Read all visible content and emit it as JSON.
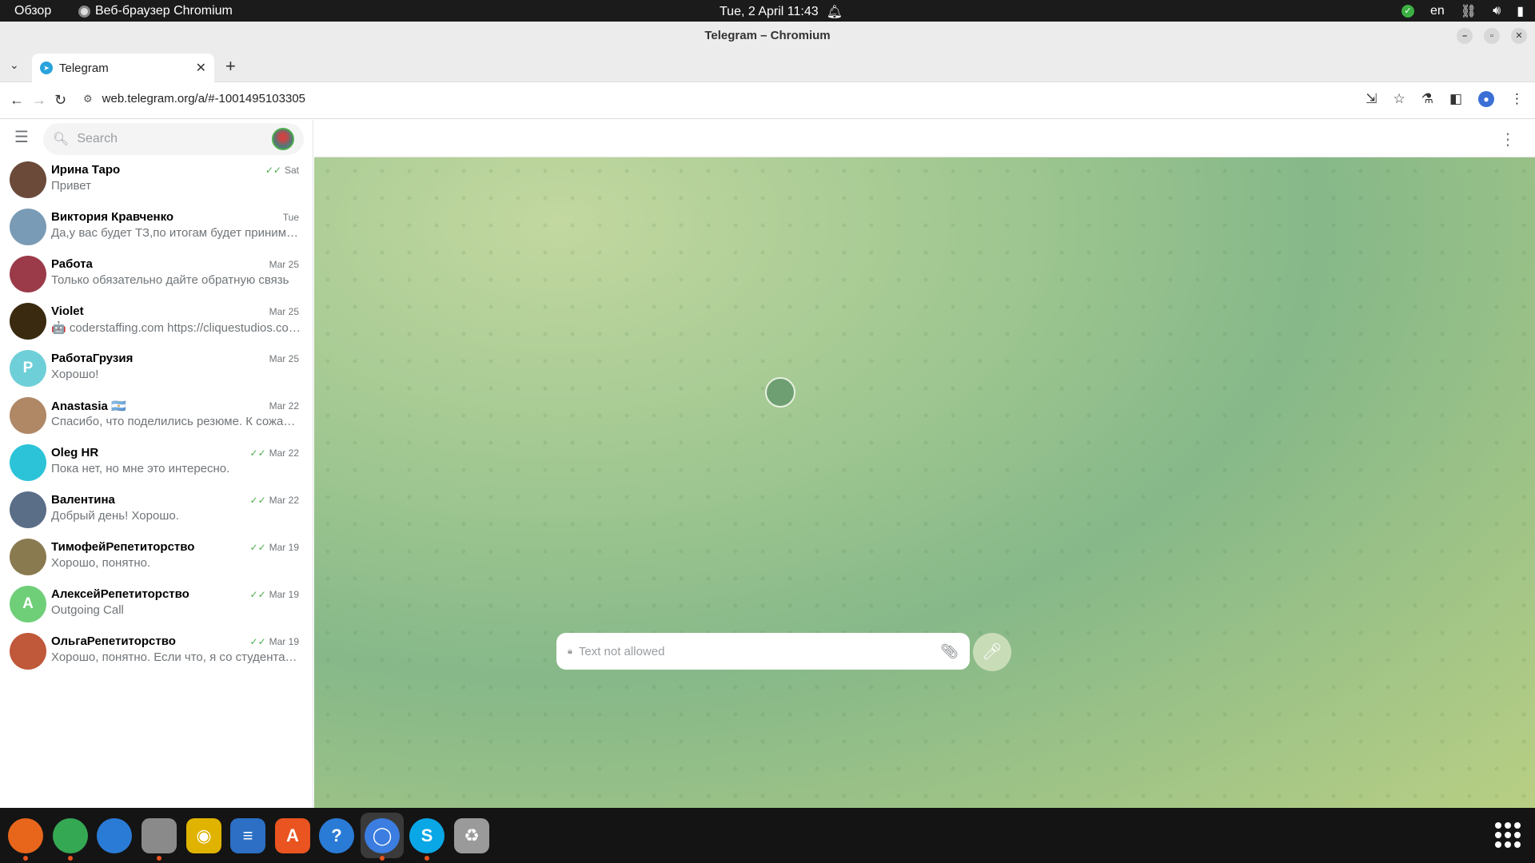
{
  "system": {
    "overview": "Обзор",
    "app_name": "Веб-браузер Chromium",
    "clock": "Tue, 2 April  11:43",
    "lang": "en"
  },
  "window": {
    "title": "Telegram – Chromium"
  },
  "browser": {
    "tab_title": "Telegram",
    "url": "web.telegram.org/a/#-1001495103305"
  },
  "telegram": {
    "search_placeholder": "Search",
    "composer_placeholder": "Text not allowed",
    "chats": [
      {
        "name": "Ирина Таро",
        "message": "Привет",
        "date": "Sat",
        "read": true,
        "avatar_color": "#6b4a3a",
        "initial": ""
      },
      {
        "name": "Виктория Кравченко",
        "message": "Да,у вас будет ТЗ,по итогам будет приниматься решение",
        "date": "Tue",
        "read": false,
        "avatar_color": "#7a9bb5",
        "initial": ""
      },
      {
        "name": "Работа",
        "message": "Только обязательно дайте обратную связь",
        "date": "Mar 25",
        "read": false,
        "avatar_color": "#9b3b4a",
        "initial": ""
      },
      {
        "name": "Violet",
        "message": "🤖 coderstaffing.com https://cliquestudios.com/",
        "date": "Mar 25",
        "read": false,
        "avatar_color": "#3a2a10",
        "initial": ""
      },
      {
        "name": "РаботаГрузия",
        "message": "Хорошо!",
        "date": "Mar 25",
        "read": false,
        "avatar_color": "#6fcfd8",
        "initial": "Р"
      },
      {
        "name": "Anastasia 🇦🇷",
        "message": "Спасибо, что поделились резюме. К сожалению, сейчас",
        "date": "Mar 22",
        "read": false,
        "avatar_color": "#b08866",
        "initial": ""
      },
      {
        "name": "Oleg HR",
        "message": "Пока нет, но мне это интересно.",
        "date": "Mar 22",
        "read": true,
        "avatar_color": "#2cc3d8",
        "initial": ""
      },
      {
        "name": "Валентина",
        "message": "Добрый день! Хорошо.",
        "date": "Mar 22",
        "read": true,
        "avatar_color": "#5a6e88",
        "initial": ""
      },
      {
        "name": "ТимофейРепетиторство",
        "message": "Хорошо, понятно.",
        "date": "Mar 19",
        "read": true,
        "avatar_color": "#8a7a50",
        "initial": ""
      },
      {
        "name": "АлексейРепетиторство",
        "message": "Outgoing Call",
        "date": "Mar 19",
        "read": true,
        "avatar_color": "#6fcf78",
        "initial": "А"
      },
      {
        "name": "ОльгаРепетиторство",
        "message": "Хорошо, понятно. Если что, я со студентами тоже работаю",
        "date": "Mar 19",
        "read": true,
        "avatar_color": "#c0583a",
        "initial": ""
      }
    ]
  },
  "dock": [
    {
      "name": "firefox",
      "color": "#e8661c",
      "glyph": "",
      "running": true
    },
    {
      "name": "chrome",
      "color": "#34a853",
      "glyph": "",
      "running": true
    },
    {
      "name": "thunderbird",
      "color": "#2a7bd6",
      "glyph": "",
      "running": false
    },
    {
      "name": "files",
      "color": "#8a8a8a",
      "glyph": "",
      "running": true
    },
    {
      "name": "rhythmbox",
      "color": "#e0b300",
      "glyph": "◉",
      "running": false
    },
    {
      "name": "writer",
      "color": "#2c6fc4",
      "glyph": "≡",
      "running": false
    },
    {
      "name": "software",
      "color": "#e95420",
      "glyph": "A",
      "running": false
    },
    {
      "name": "help",
      "color": "#2a7bd6",
      "glyph": "?",
      "running": false
    },
    {
      "name": "chromium",
      "color": "#3b7de0",
      "glyph": "◯",
      "running": true
    },
    {
      "name": "skype",
      "color": "#0aa7e6",
      "glyph": "S",
      "running": true
    },
    {
      "name": "trash",
      "color": "#9a9a9a",
      "glyph": "♻",
      "running": false
    }
  ]
}
